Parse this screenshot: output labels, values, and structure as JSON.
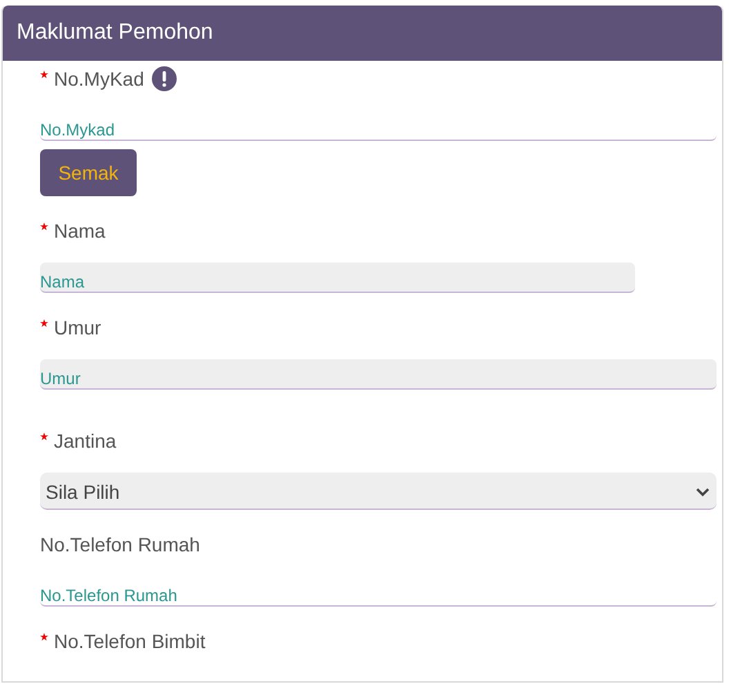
{
  "panel": {
    "title": "Maklumat Pemohon"
  },
  "fields": [
    {
      "label": "No.MyKad",
      "required": true,
      "info": true,
      "kind": "text",
      "disabled": false,
      "placeholder": "No.Mykad",
      "button": "Semak"
    },
    {
      "label": "Nama",
      "required": true,
      "kind": "text",
      "disabled": true,
      "placeholder": "Nama"
    },
    {
      "label": "Umur",
      "required": true,
      "kind": "text",
      "disabled": true,
      "placeholder": "Umur"
    },
    {
      "label": "Jantina",
      "required": true,
      "kind": "select",
      "disabled": false,
      "value": "Sila Pilih"
    },
    {
      "label": "No.Telefon Rumah",
      "required": false,
      "kind": "text",
      "disabled": false,
      "placeholder": "No.Telefon Rumah"
    },
    {
      "label": "No.Telefon Bimbit",
      "required": true,
      "kind": "none"
    }
  ]
}
